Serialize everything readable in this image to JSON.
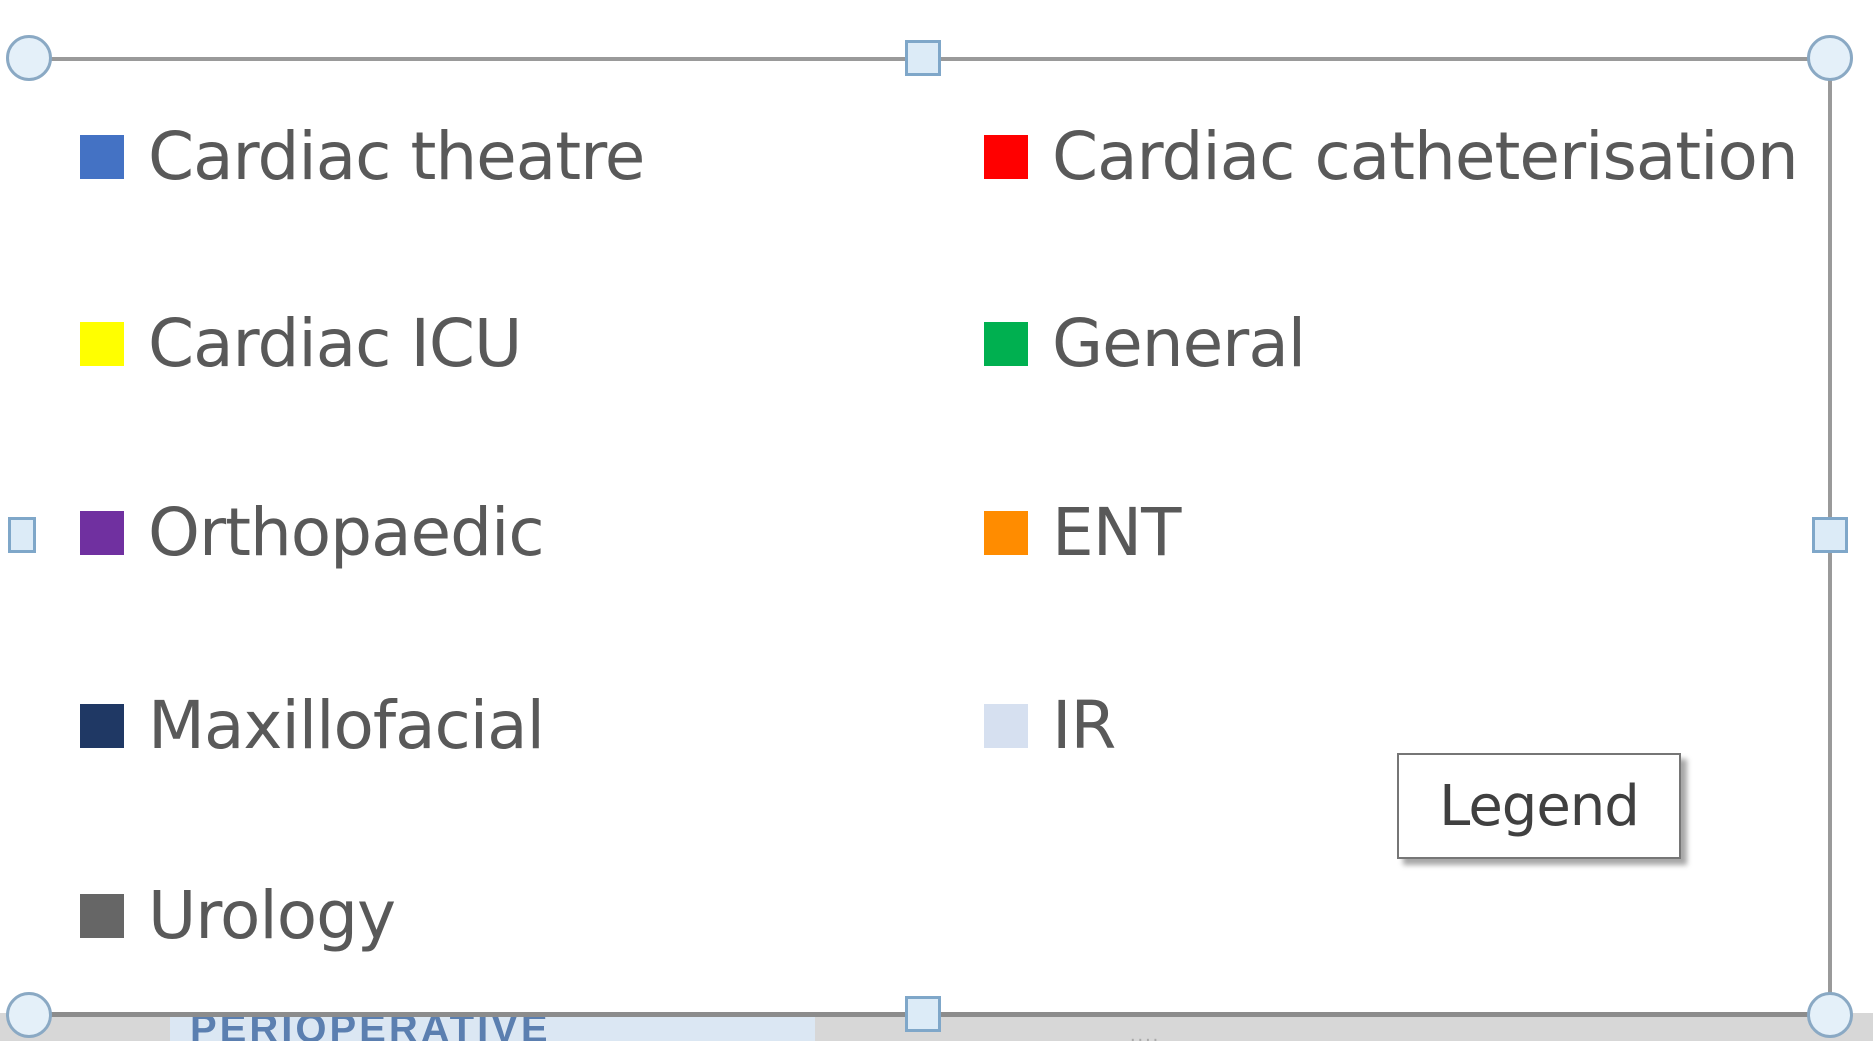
{
  "legend": {
    "entries": [
      {
        "label": "Cardiac theatre",
        "color": "#4472c4"
      },
      {
        "label": "Cardiac catheterisation",
        "color": "#ff0000"
      },
      {
        "label": "Cardiac ICU",
        "color": "#ffff00"
      },
      {
        "label": "General",
        "color": "#00b050"
      },
      {
        "label": "Orthopaedic",
        "color": "#7030a0"
      },
      {
        "label": "ENT",
        "color": "#ff8c00"
      },
      {
        "label": "Maxillofacial",
        "color": "#1f3864"
      },
      {
        "label": "IR",
        "color": "#d6e0f0"
      },
      {
        "label": "Urology",
        "color": "#666666"
      }
    ]
  },
  "tooltip": {
    "text": "Legend"
  },
  "background": {
    "partial_heading": "PERIOPERATIVE",
    "partial_dots": "...."
  }
}
